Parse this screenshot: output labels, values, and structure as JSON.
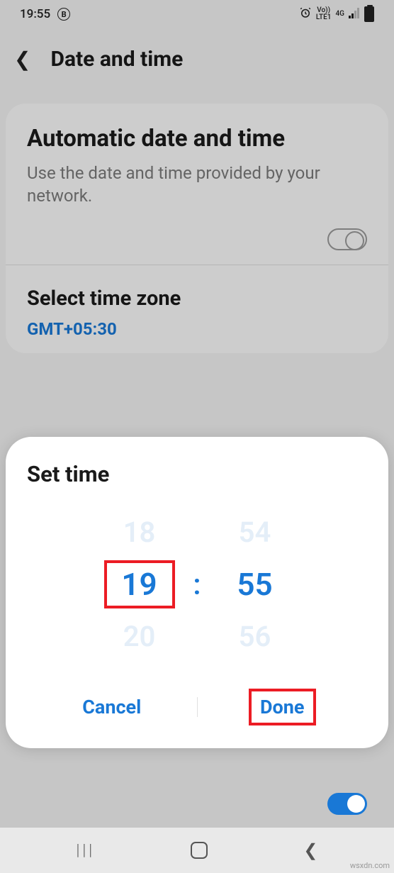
{
  "statusbar": {
    "time": "19:55",
    "badge": "B",
    "network_top": "Vo))",
    "network_bot": "LTE1",
    "cell": "4G"
  },
  "header": {
    "title": "Date and time"
  },
  "auto": {
    "title": "Automatic date and time",
    "subtitle": "Use the date and time provided by your network."
  },
  "tz": {
    "label": "Select time zone",
    "value": "GMT+05:30"
  },
  "dialog": {
    "title": "Set time",
    "hour_prev": "18",
    "hour_sel": "19",
    "hour_next": "20",
    "min_prev": "54",
    "min_sel": "55",
    "min_next": "56",
    "colon": ":",
    "cancel": "Cancel",
    "done": "Done"
  },
  "watermark": "wsxdn.com"
}
